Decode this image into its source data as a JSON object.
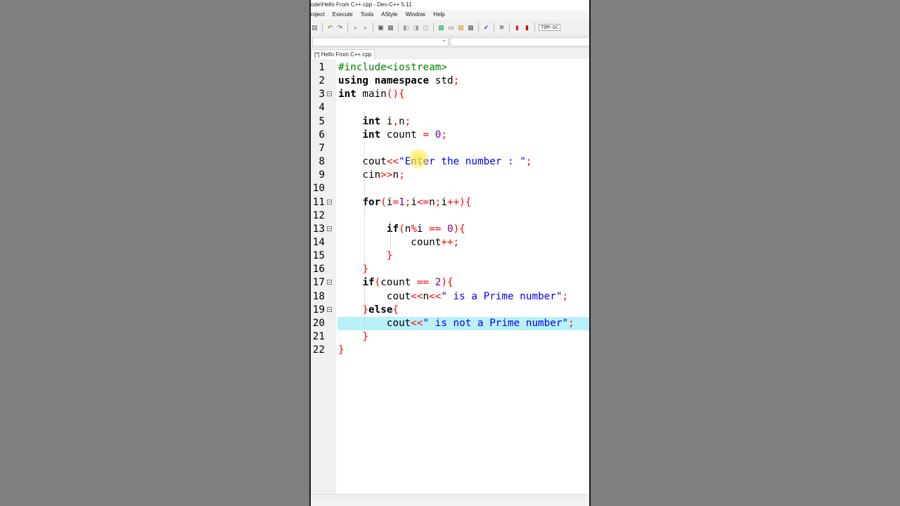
{
  "window": {
    "title": "ode\\Hello From C++.cpp - Dev-C++ 5.11"
  },
  "menu": [
    "roject",
    "Execute",
    "Tools",
    "AStyle",
    "Window",
    "Help"
  ],
  "toolbar": {
    "combo_label": "TDM-GC"
  },
  "tab": {
    "label": "[*] Hello From C++.cpp"
  },
  "editor": {
    "lines": [
      {
        "n": "1",
        "fold": false,
        "tokens": [
          [
            "pp",
            "#include<iostream>"
          ]
        ]
      },
      {
        "n": "2",
        "fold": false,
        "tokens": [
          [
            "kw",
            "using namespace"
          ],
          [
            "id",
            " std"
          ],
          [
            "sym",
            ";"
          ]
        ]
      },
      {
        "n": "3",
        "fold": true,
        "tokens": [
          [
            "kw",
            "int"
          ],
          [
            "id",
            " main"
          ],
          [
            "sym",
            "(){"
          ]
        ]
      },
      {
        "n": "4",
        "fold": false,
        "tokens": []
      },
      {
        "n": "5",
        "fold": false,
        "tokens": [
          [
            "id",
            "    "
          ],
          [
            "kw",
            "int"
          ],
          [
            "id",
            " i"
          ],
          [
            "sym",
            ","
          ],
          [
            "id",
            "n"
          ],
          [
            "sym",
            ";"
          ]
        ]
      },
      {
        "n": "6",
        "fold": false,
        "tokens": [
          [
            "id",
            "    "
          ],
          [
            "kw",
            "int"
          ],
          [
            "id",
            " count "
          ],
          [
            "sym",
            "="
          ],
          [
            "id",
            " "
          ],
          [
            "num",
            "0"
          ],
          [
            "sym",
            ";"
          ]
        ]
      },
      {
        "n": "7",
        "fold": false,
        "tokens": []
      },
      {
        "n": "8",
        "fold": false,
        "tokens": [
          [
            "id",
            "    cout"
          ],
          [
            "sym",
            "<<"
          ],
          [
            "str",
            "\"Enter the number : \""
          ],
          [
            "sym",
            ";"
          ]
        ]
      },
      {
        "n": "9",
        "fold": false,
        "tokens": [
          [
            "id",
            "    cin"
          ],
          [
            "sym",
            ">>"
          ],
          [
            "id",
            "n"
          ],
          [
            "sym",
            ";"
          ]
        ]
      },
      {
        "n": "10",
        "fold": false,
        "tokens": []
      },
      {
        "n": "11",
        "fold": true,
        "tokens": [
          [
            "id",
            "    "
          ],
          [
            "kw",
            "for"
          ],
          [
            "sym",
            "("
          ],
          [
            "id",
            "i"
          ],
          [
            "sym",
            "="
          ],
          [
            "num",
            "1"
          ],
          [
            "sym",
            ";"
          ],
          [
            "id",
            "i"
          ],
          [
            "sym",
            "<="
          ],
          [
            "id",
            "n"
          ],
          [
            "sym",
            ";"
          ],
          [
            "id",
            "i"
          ],
          [
            "sym",
            "++){"
          ]
        ]
      },
      {
        "n": "12",
        "fold": false,
        "tokens": []
      },
      {
        "n": "13",
        "fold": true,
        "tokens": [
          [
            "id",
            "        "
          ],
          [
            "kw",
            "if"
          ],
          [
            "sym",
            "("
          ],
          [
            "id",
            "n"
          ],
          [
            "sym",
            "%"
          ],
          [
            "id",
            "i "
          ],
          [
            "sym",
            "=="
          ],
          [
            "id",
            " "
          ],
          [
            "num",
            "0"
          ],
          [
            "sym",
            "){"
          ]
        ]
      },
      {
        "n": "14",
        "fold": false,
        "tokens": [
          [
            "id",
            "            count"
          ],
          [
            "sym",
            "++;"
          ]
        ]
      },
      {
        "n": "15",
        "fold": false,
        "tokens": [
          [
            "id",
            "        "
          ],
          [
            "sym",
            "}"
          ]
        ]
      },
      {
        "n": "16",
        "fold": false,
        "tokens": [
          [
            "id",
            "    "
          ],
          [
            "sym",
            "}"
          ]
        ]
      },
      {
        "n": "17",
        "fold": true,
        "tokens": [
          [
            "id",
            "    "
          ],
          [
            "kw",
            "if"
          ],
          [
            "sym",
            "("
          ],
          [
            "id",
            "count "
          ],
          [
            "sym",
            "=="
          ],
          [
            "id",
            " "
          ],
          [
            "num",
            "2"
          ],
          [
            "sym",
            "){"
          ]
        ]
      },
      {
        "n": "18",
        "fold": false,
        "tokens": [
          [
            "id",
            "        cout"
          ],
          [
            "sym",
            "<<"
          ],
          [
            "id",
            "n"
          ],
          [
            "sym",
            "<<"
          ],
          [
            "str",
            "\" is a Prime number\""
          ],
          [
            "sym",
            ";"
          ]
        ]
      },
      {
        "n": "19",
        "fold": true,
        "tokens": [
          [
            "id",
            "    "
          ],
          [
            "sym",
            "}"
          ],
          [
            "kw",
            "else"
          ],
          [
            "sym",
            "{"
          ]
        ]
      },
      {
        "n": "20",
        "fold": false,
        "tokens": [
          [
            "id",
            "        cout"
          ],
          [
            "sym",
            "<<"
          ],
          [
            "str",
            "\" is not a Prime number\""
          ],
          [
            "sym",
            ";"
          ]
        ],
        "highlight": true
      },
      {
        "n": "21",
        "fold": false,
        "tokens": [
          [
            "id",
            "    "
          ],
          [
            "sym",
            "}"
          ]
        ]
      },
      {
        "n": "22",
        "fold": false,
        "tokens": [
          [
            "sym",
            "}"
          ]
        ]
      }
    ]
  }
}
